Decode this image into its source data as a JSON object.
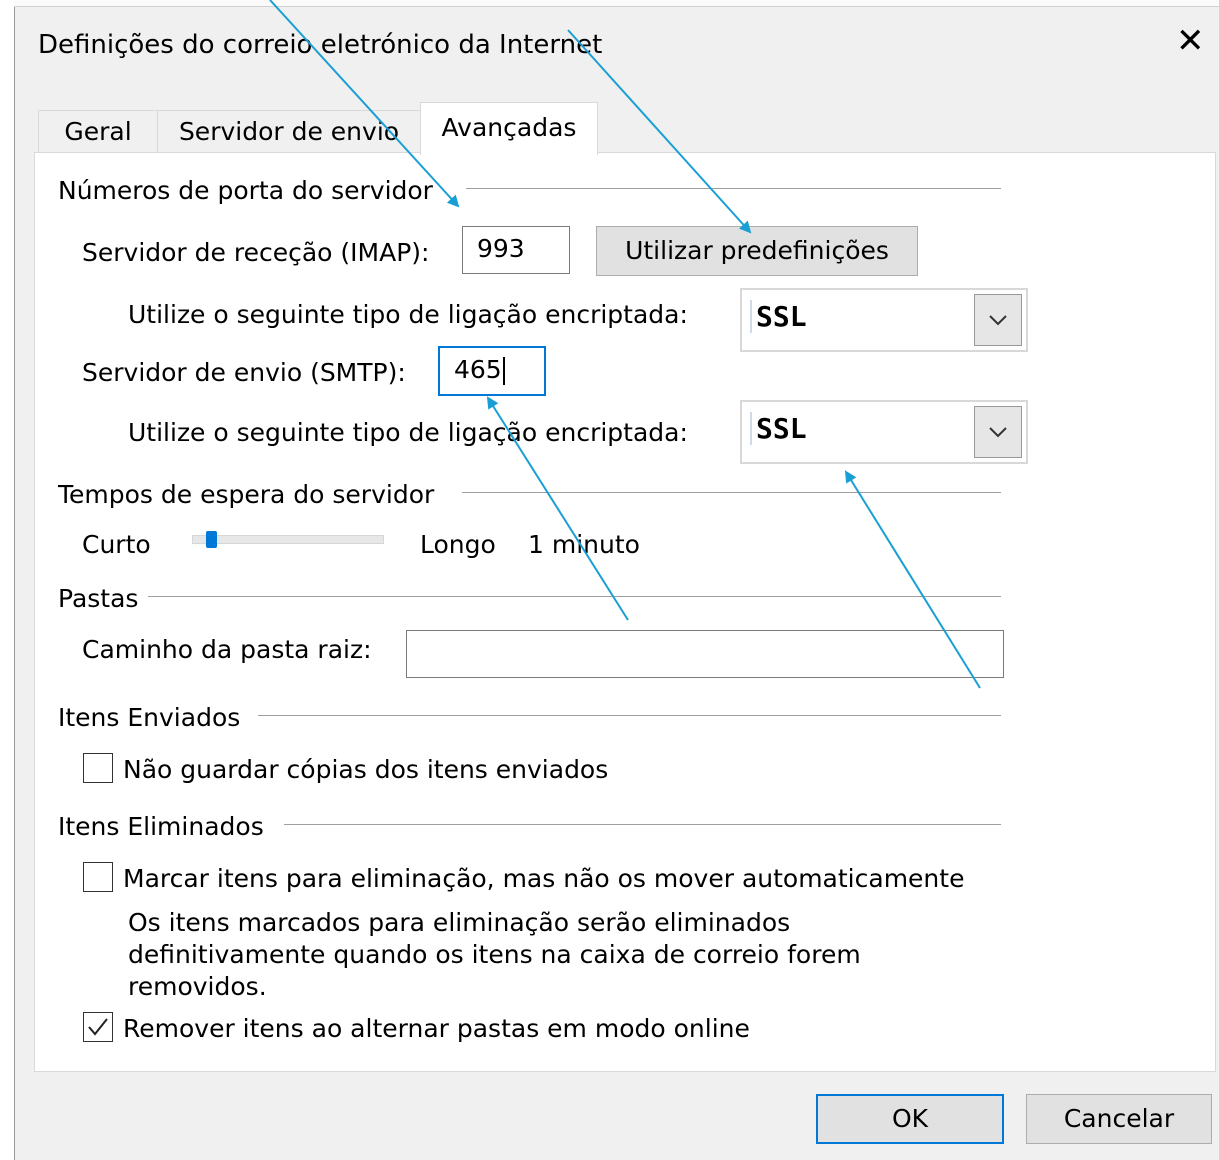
{
  "window": {
    "title": "Definições do correio eletrónico da Internet",
    "close_icon": "close-icon"
  },
  "tabs": [
    {
      "label": "Geral",
      "active": false
    },
    {
      "label": "Servidor de envio",
      "active": false
    },
    {
      "label": "Avançadas",
      "active": true
    }
  ],
  "ports": {
    "group_label": "Números de porta do servidor",
    "incoming_label": "Servidor de receção (IMAP):",
    "incoming_value": "993",
    "defaults_button": "Utilizar predefinições",
    "incoming_encryption_label": "Utilize o seguinte tipo de ligação encriptada:",
    "incoming_encryption_value": "SSL",
    "outgoing_label": "Servidor de envio (SMTP):",
    "outgoing_value": "465",
    "outgoing_encryption_label": "Utilize o seguinte tipo de ligação encriptada:",
    "outgoing_encryption_value": "SSL"
  },
  "timeouts": {
    "group_label": "Tempos de espera do servidor",
    "short_label": "Curto",
    "long_label": "Longo",
    "value_text": "1 minuto",
    "slider_level": 0.1
  },
  "folders": {
    "group_label": "Pastas",
    "root_path_label": "Caminho da pasta raiz:",
    "root_path_value": ""
  },
  "sent_items": {
    "group_label": "Itens Enviados",
    "dont_save_label": "Não guardar cópias dos itens enviados",
    "dont_save_checked": false
  },
  "deleted_items": {
    "group_label": "Itens Eliminados",
    "mark_label": "Marcar itens para eliminação, mas não os mover automaticamente",
    "mark_checked": false,
    "mark_note_1": "Os itens marcados para eliminação serão eliminados",
    "mark_note_2": "definitivamente quando os itens na caixa de correio forem",
    "mark_note_3": "removidos.",
    "purge_label": "Remover itens ao alternar pastas em modo online",
    "purge_checked": true
  },
  "footer": {
    "ok_label": "OK",
    "cancel_label": "Cancelar"
  },
  "colors": {
    "accent": "#0078d7",
    "annotation_arrow": "#1a9fd4"
  }
}
